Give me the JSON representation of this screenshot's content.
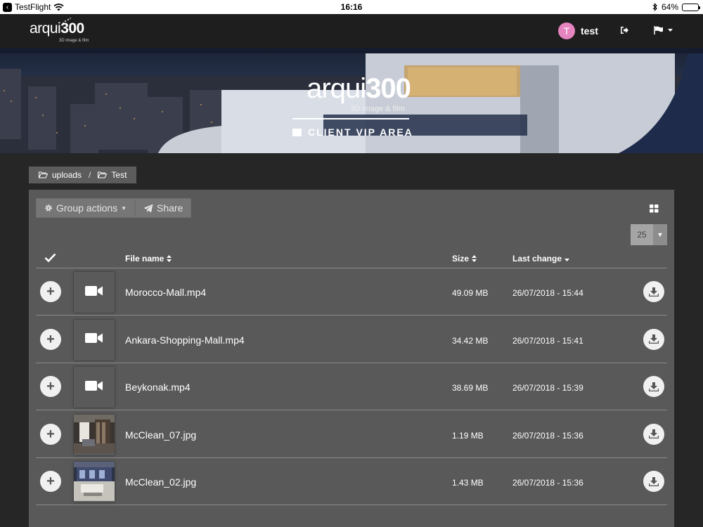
{
  "status_bar": {
    "app": "TestFlight",
    "time": "16:16",
    "battery": "64%",
    "battery_level": 0.64
  },
  "nav": {
    "logo_word": "arqui",
    "logo_number": "300",
    "logo_sub": "3D image & film",
    "user_initial": "T",
    "username": "test",
    "colors": {
      "avatar": "#e684c0",
      "navbar": "#1e1e1e"
    }
  },
  "banner": {
    "logo_word": "arqui",
    "logo_number": "300",
    "logo_sub": "3D image & film",
    "area_label": "CLIENT VIP AREA"
  },
  "breadcrumb": [
    {
      "label": "uploads"
    },
    {
      "label": "Test"
    }
  ],
  "toolbar": {
    "group_actions": "Group actions",
    "share": "Share",
    "per_page": "25"
  },
  "table": {
    "columns": {
      "name": "File name",
      "size": "Size",
      "date": "Last change"
    },
    "rows": [
      {
        "name": "Morocco-Mall.mp4",
        "size": "49.09 MB",
        "date": "26/07/2018 - 15:44",
        "type": "video"
      },
      {
        "name": "Ankara-Shopping-Mall.mp4",
        "size": "34.42 MB",
        "date": "26/07/2018 - 15:41",
        "type": "video"
      },
      {
        "name": "Beykonak.mp4",
        "size": "38.69 MB",
        "date": "26/07/2018 - 15:39",
        "type": "video"
      },
      {
        "name": "McClean_07.jpg",
        "size": "1.19 MB",
        "date": "26/07/2018 - 15:36",
        "type": "image"
      },
      {
        "name": "McClean_02.jpg",
        "size": "1.43 MB",
        "date": "26/07/2018 - 15:36",
        "type": "image"
      }
    ]
  }
}
